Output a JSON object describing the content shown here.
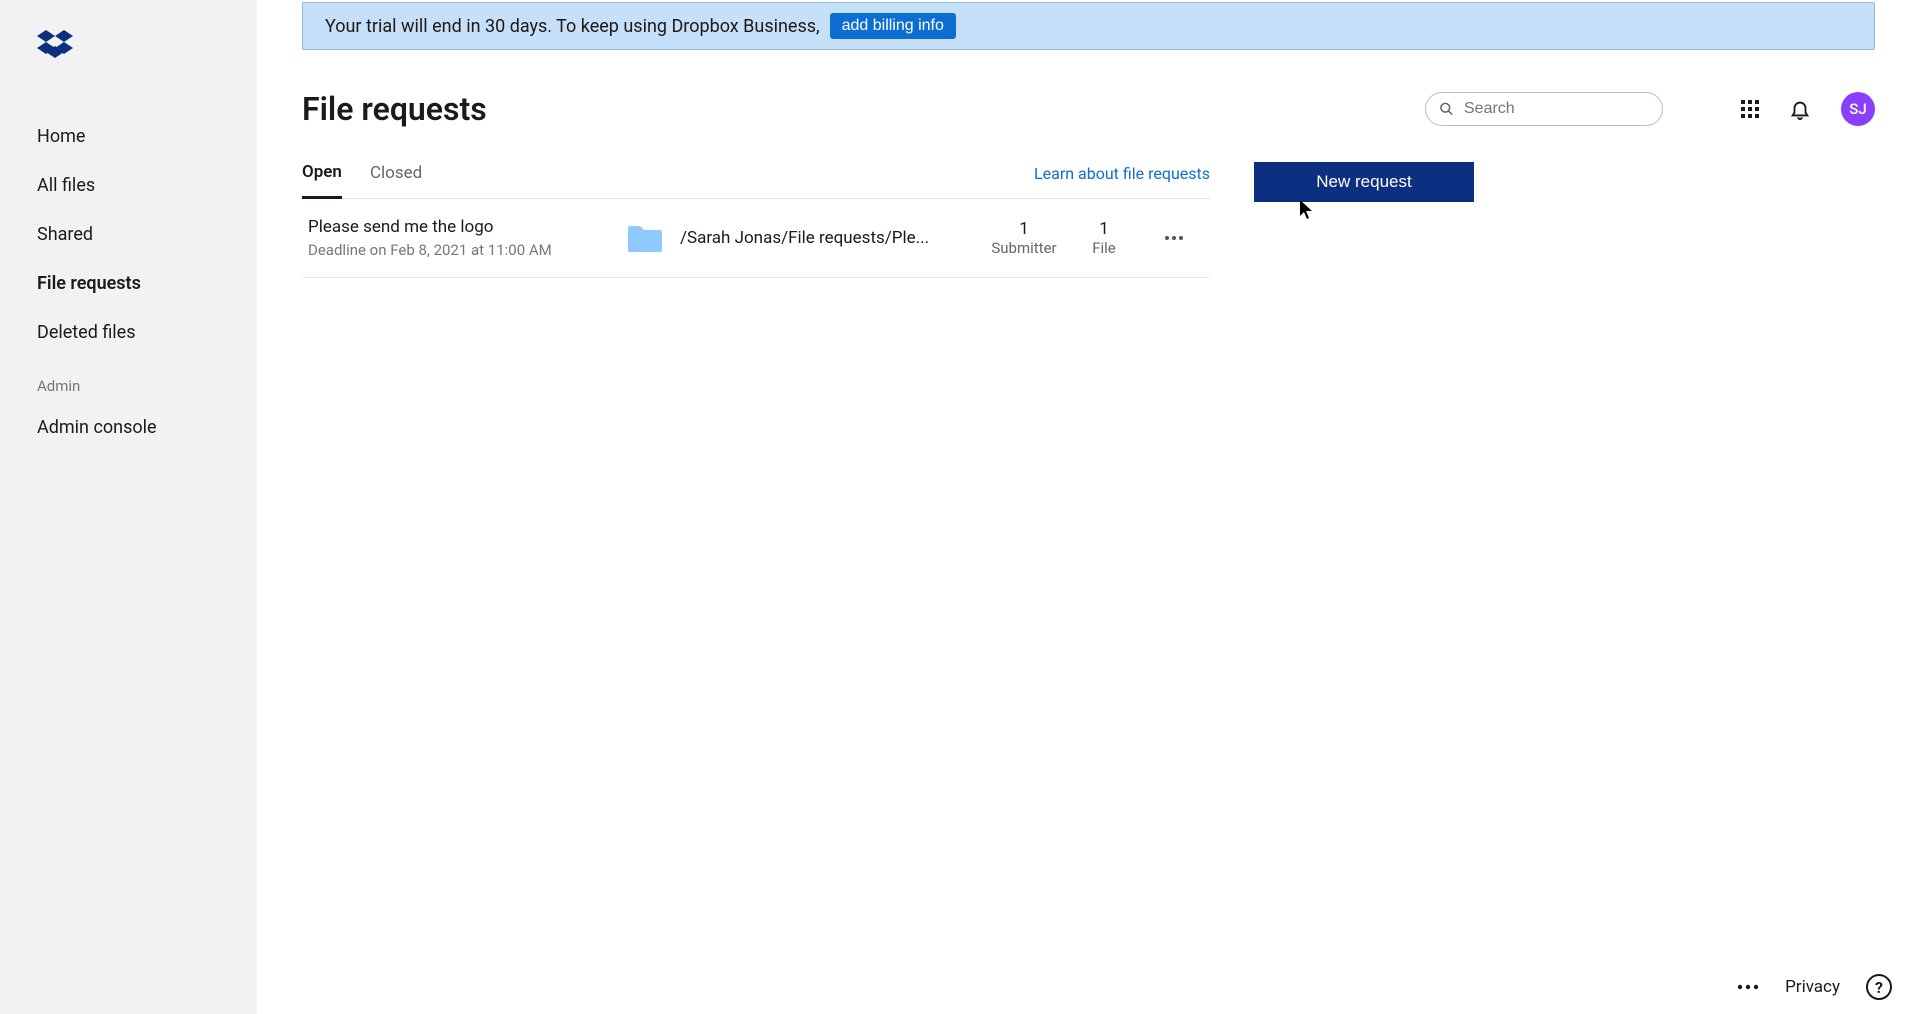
{
  "banner": {
    "text": "Your trial will end in 30 days. To keep using Dropbox Business,",
    "button": "add billing info"
  },
  "sidebar": {
    "items": [
      {
        "label": "Home"
      },
      {
        "label": "All files"
      },
      {
        "label": "Shared"
      },
      {
        "label": "File requests"
      },
      {
        "label": "Deleted files"
      }
    ],
    "section_label": "Admin",
    "admin_item": "Admin console"
  },
  "header": {
    "title": "File requests",
    "search_placeholder": "Search",
    "avatar": "SJ"
  },
  "tabs": {
    "open": "Open",
    "closed": "Closed",
    "learn": "Learn about file requests"
  },
  "row": {
    "title": "Please send me the logo",
    "deadline": "Deadline on Feb 8, 2021 at 11:00 AM",
    "path": "/Sarah Jonas/File requests/Ple...",
    "sub_count": "1",
    "sub_label": "Submitter",
    "file_count": "1",
    "file_label": "File"
  },
  "actions": {
    "new_request": "New request"
  },
  "footer": {
    "privacy": "Privacy",
    "help": "?"
  }
}
